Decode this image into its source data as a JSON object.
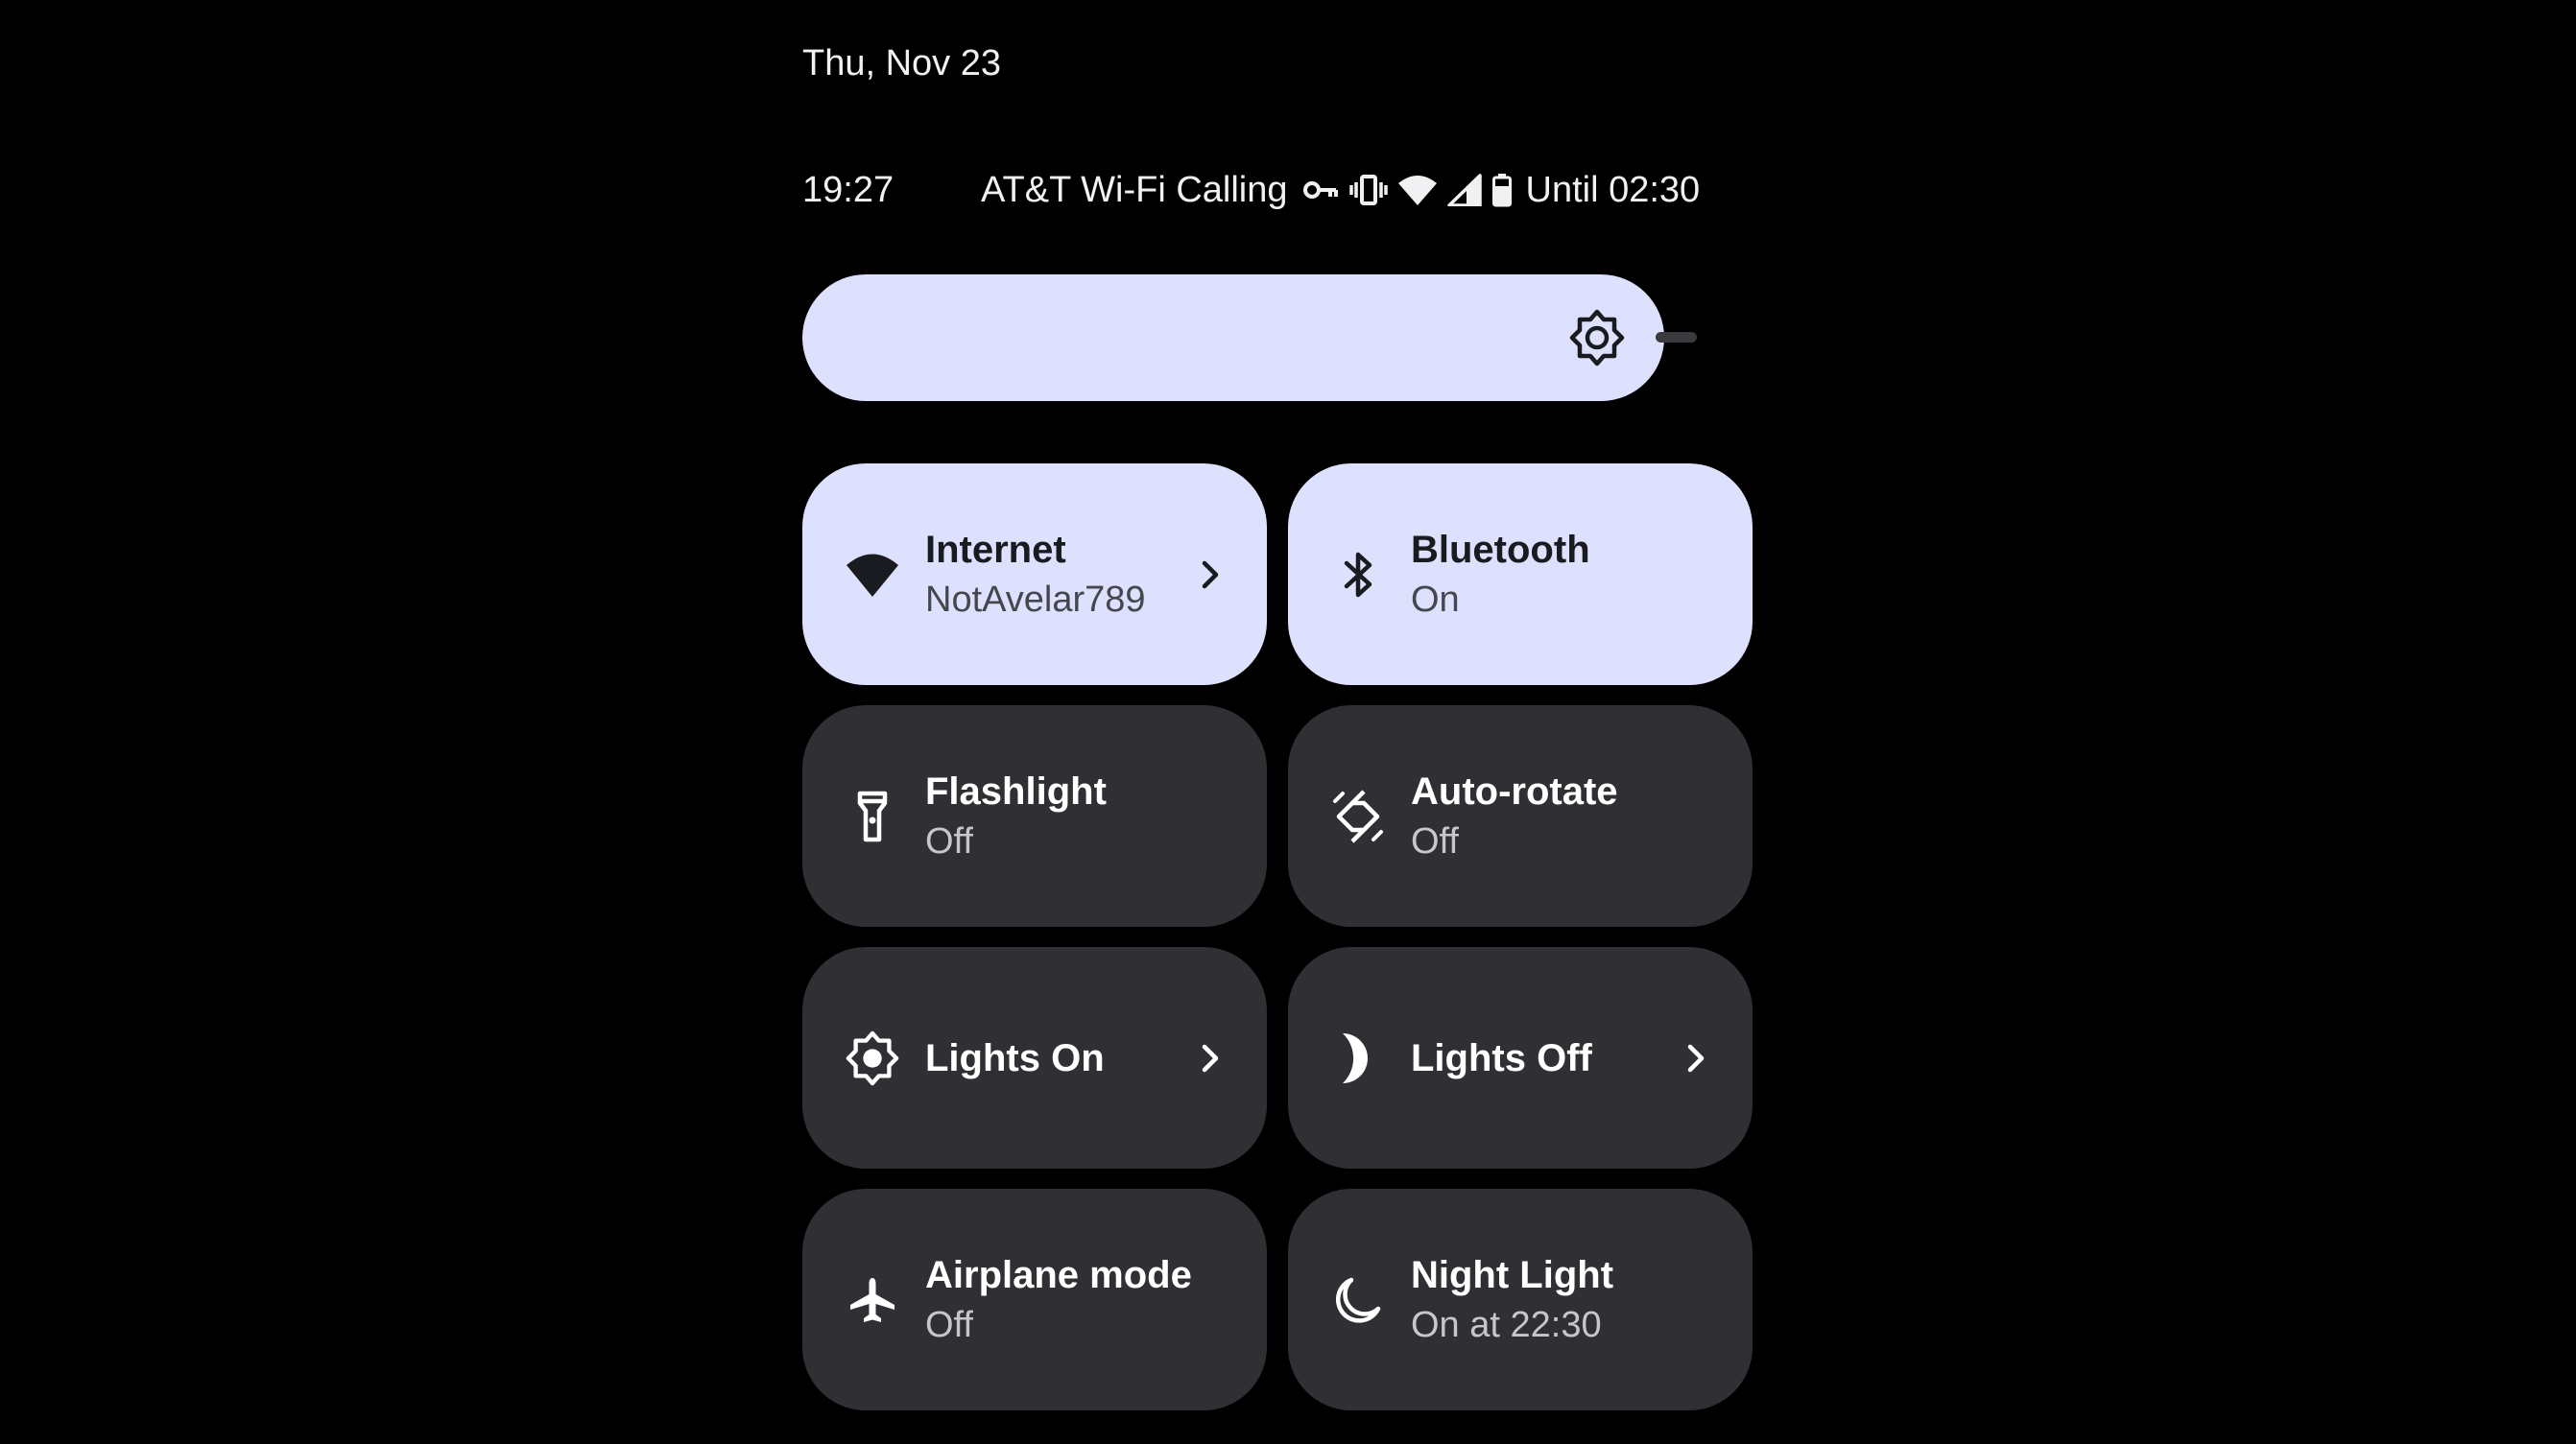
{
  "header": {
    "date": "Thu, Nov 23"
  },
  "status_bar": {
    "time": "19:27",
    "carrier": "AT&T Wi-Fi Calling",
    "battery_text": "Until 02:30",
    "icons": [
      "vpn-key-icon",
      "vibrate-icon",
      "wifi-icon",
      "cell-signal-icon",
      "battery-icon"
    ]
  },
  "brightness": {
    "icon": "brightness-icon",
    "level_fraction": 0.96
  },
  "tiles": [
    {
      "label": "Internet",
      "sub": "NotAvelar789",
      "icon": "wifi-icon",
      "active": true,
      "chevron": true
    },
    {
      "label": "Bluetooth",
      "sub": "On",
      "icon": "bluetooth-icon",
      "active": true,
      "chevron": false
    },
    {
      "label": "Flashlight",
      "sub": "Off",
      "icon": "flashlight-icon",
      "active": false,
      "chevron": false
    },
    {
      "label": "Auto-rotate",
      "sub": "Off",
      "icon": "auto-rotate-icon",
      "active": false,
      "chevron": false
    },
    {
      "label": "Lights On",
      "sub": "",
      "icon": "sun-icon",
      "active": false,
      "chevron": true
    },
    {
      "label": "Lights Off",
      "sub": "",
      "icon": "moon-icon",
      "active": false,
      "chevron": true
    },
    {
      "label": "Airplane mode",
      "sub": "Off",
      "icon": "airplane-icon",
      "active": false,
      "chevron": false
    },
    {
      "label": "Night Light",
      "sub": "On at 22:30",
      "icon": "night-light-icon",
      "active": false,
      "chevron": false
    }
  ],
  "colors": {
    "background": "#000000",
    "tile_active": "#dde1fd",
    "tile_inactive": "#303034"
  }
}
